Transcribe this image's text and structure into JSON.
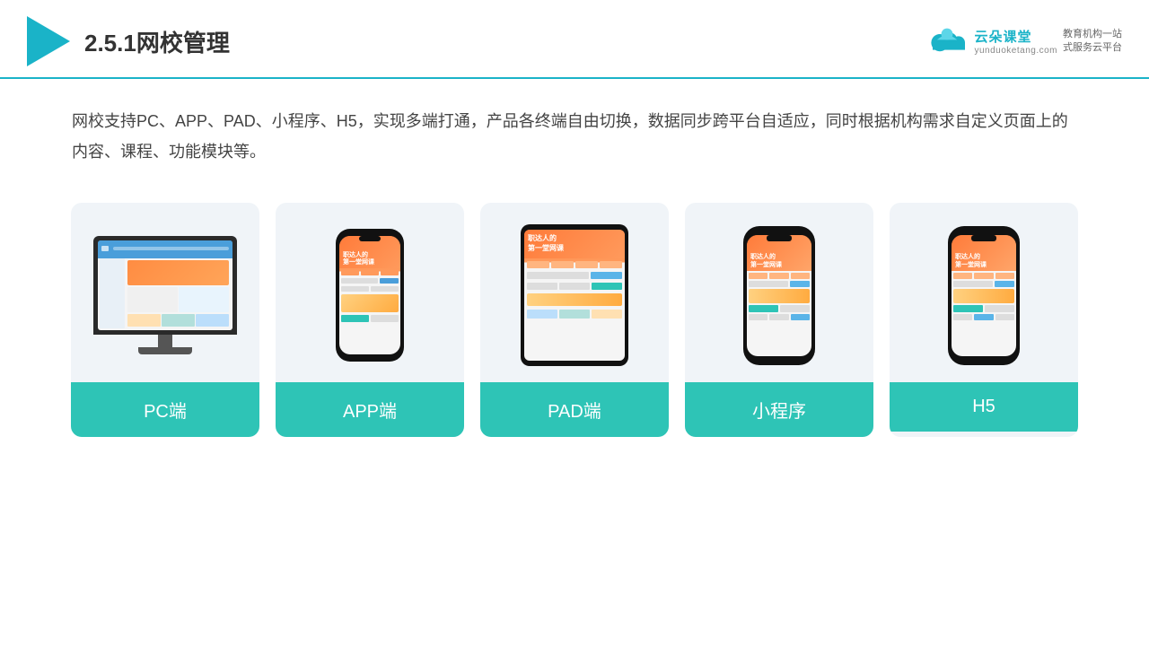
{
  "header": {
    "title": "2.5.1网校管理",
    "logo_main": "云朵课堂",
    "logo_url": "yunduoketang.com",
    "logo_slogan": "教育机构一站\n式服务云平台"
  },
  "description": {
    "text": "网校支持PC、APP、PAD、小程序、H5，实现多端打通，产品各终端自由切换，数据同步跨平台自适应，同时根据机构需求自定义页面上的内容、课程、功能模块等。"
  },
  "cards": [
    {
      "id": "pc",
      "label": "PC端"
    },
    {
      "id": "app",
      "label": "APP端"
    },
    {
      "id": "pad",
      "label": "PAD端"
    },
    {
      "id": "miniapp",
      "label": "小程序"
    },
    {
      "id": "h5",
      "label": "H5"
    }
  ]
}
